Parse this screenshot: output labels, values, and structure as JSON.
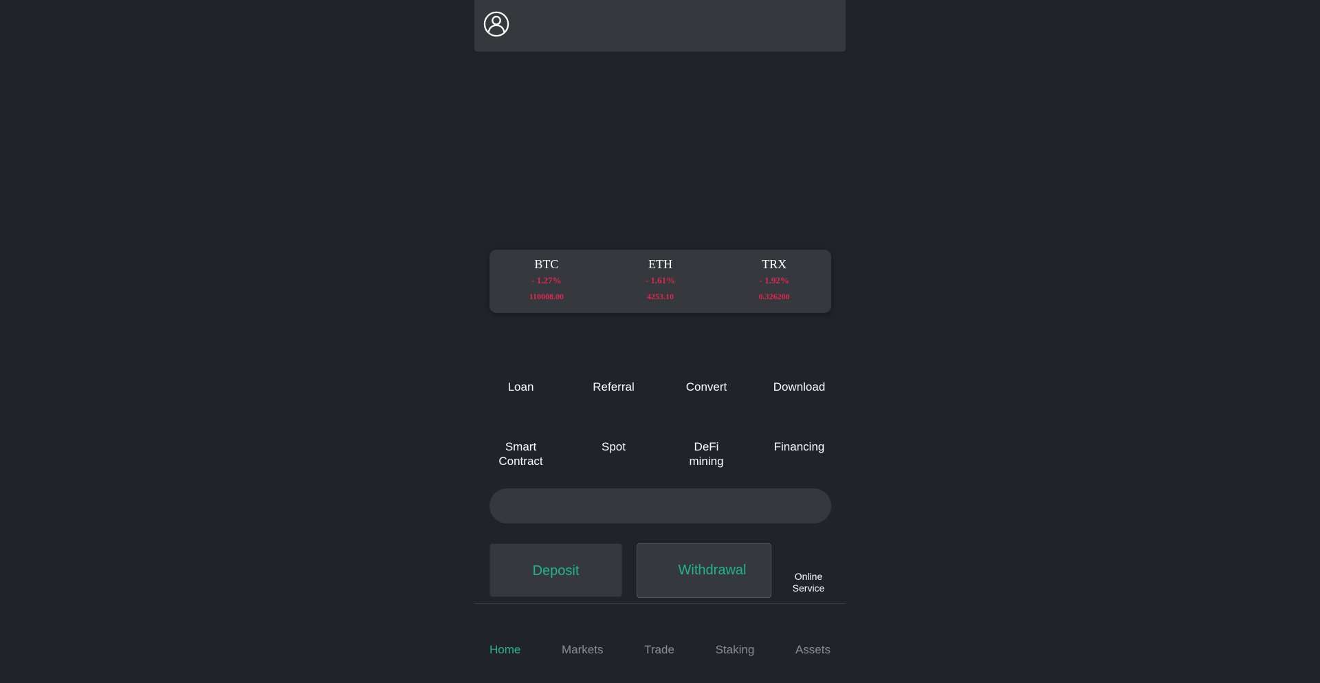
{
  "colors": {
    "background": "#202329",
    "card": "#35383d",
    "accent": "#22b58f",
    "negative": "#e0284f",
    "nav_inactive": "#8a8d93"
  },
  "header": {
    "avatar_icon": "user-circle-icon"
  },
  "tickers": [
    {
      "symbol": "BTC",
      "change": "- 1.27%",
      "price": "110008.00"
    },
    {
      "symbol": "ETH",
      "change": "- 1.61%",
      "price": "4253.10"
    },
    {
      "symbol": "TRX",
      "change": "- 1.92%",
      "price": "0.326200"
    }
  ],
  "menu": {
    "row1": [
      "Loan",
      "Referral",
      "Convert",
      "Download"
    ],
    "row2": [
      {
        "line1": "Smart",
        "line2": "Contract"
      },
      {
        "line1": "Spot",
        "line2": ""
      },
      {
        "line1": "DeFi",
        "line2": "mining"
      },
      {
        "line1": "Financing",
        "line2": ""
      }
    ]
  },
  "actions": {
    "deposit": "Deposit",
    "withdrawal": "Withdrawal",
    "online_service_line1": "Online",
    "online_service_line2": "Service"
  },
  "bottom_nav": {
    "active": "Home",
    "items": [
      "Home",
      "Markets",
      "Trade",
      "Staking",
      "Assets"
    ]
  }
}
